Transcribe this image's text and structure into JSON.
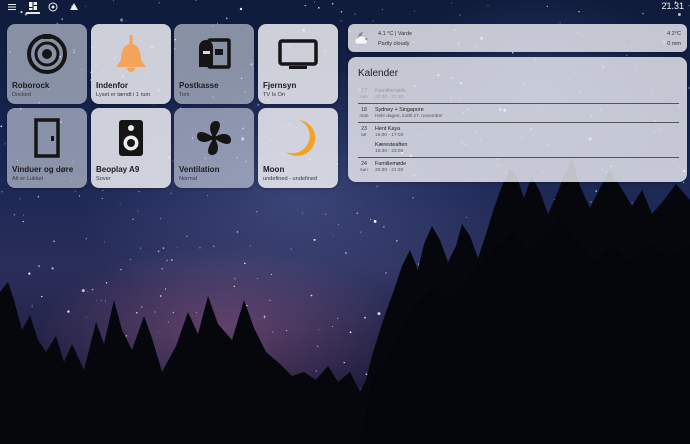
{
  "topbar": {
    "icons": [
      "menu-icon",
      "dashboard-icon",
      "home-assistant-icon",
      "alarm-icon"
    ],
    "clock": "21.31"
  },
  "tiles": [
    {
      "name": "Roborock",
      "state": "Docked",
      "icon": "robot-vacuum-icon",
      "active": false
    },
    {
      "name": "Indenfor",
      "state": "Lyset er tændt i 1 rum",
      "icon": "ceiling-lamp-icon",
      "active": true
    },
    {
      "name": "Postkasse",
      "state": "Tom",
      "icon": "mailbox-icon",
      "active": false
    },
    {
      "name": "Fjernsyn",
      "state": "TV Is On",
      "icon": "tv-icon",
      "active": true
    },
    {
      "name": "Vinduer og døre",
      "state": "Alt er Lukket",
      "icon": "door-icon",
      "active": false
    },
    {
      "name": "Beoplay A9",
      "state": "Sover",
      "icon": "speaker-icon",
      "active": true
    },
    {
      "name": "Ventilation",
      "state": "Normal",
      "icon": "fan-icon",
      "active": false
    },
    {
      "name": "Moon",
      "state": "undefined - undefined",
      "icon": "moon-icon",
      "active": true
    }
  ],
  "weather": {
    "title": "4.1 °C | Varde",
    "condition": "Partly cloudy",
    "temp": "4.2°C",
    "precip": "0 mm",
    "icon": "partly-cloudy-night-icon"
  },
  "calendar": {
    "title": "Kalender",
    "events": [
      {
        "day": "17",
        "weekday": "søn",
        "title": "Familiemøde",
        "time": "20:30 - 21:30",
        "past": true
      },
      {
        "day": "18",
        "weekday": "man",
        "title": "Sydney + Singapore",
        "time": "Hele dagen, indtil 27. november",
        "past": false
      },
      {
        "day": "23",
        "weekday": "lør",
        "title": "Hent Kaya",
        "time": "16:00 - 17:00",
        "past": false
      },
      {
        "day": "",
        "weekday": "",
        "title": "Kæresteaften",
        "time": "18:30 - 23:00",
        "past": false
      },
      {
        "day": "24",
        "weekday": "søn",
        "title": "Familiemøde",
        "time": "20:30 - 21:30",
        "past": false
      }
    ]
  },
  "colors": {
    "lamp_orange": "#f5a25b",
    "moon_orange": "#f2a321",
    "icon_dark": "#151515"
  }
}
